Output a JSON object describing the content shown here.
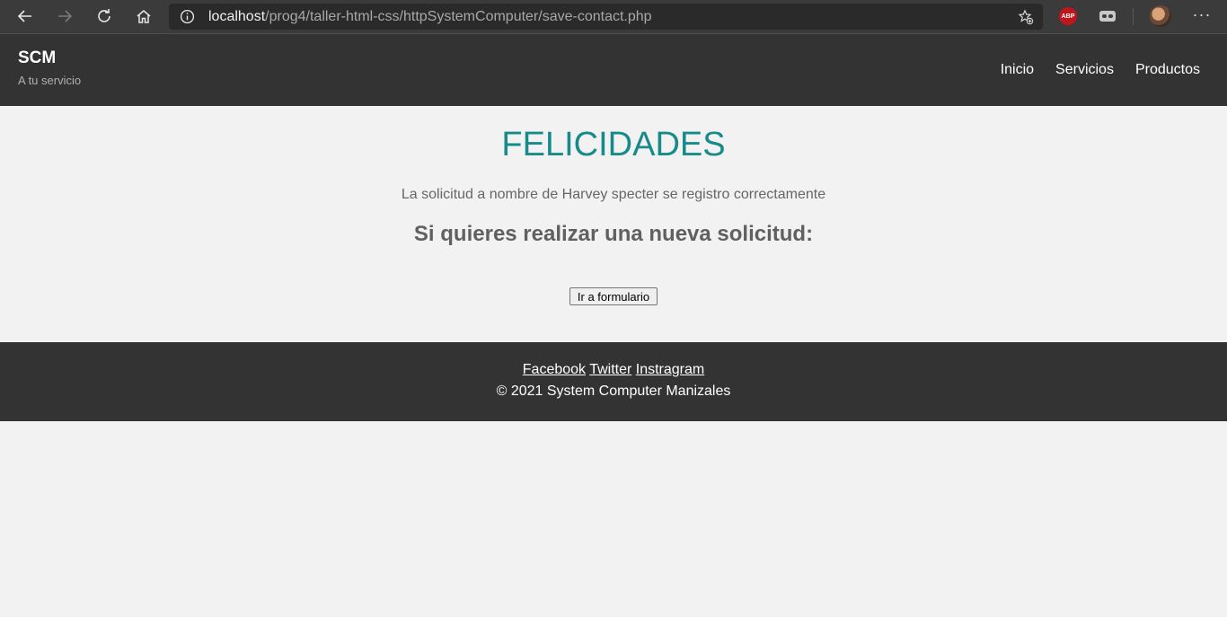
{
  "browser": {
    "url_host": "localhost",
    "url_path": "/prog4/taller-html-css/httpSystemComputer/save-contact.php",
    "abp_label": "ABP",
    "more_label": "···"
  },
  "header": {
    "brand": "SCM",
    "tagline": "A tu servicio",
    "nav": [
      "Inicio",
      "Servicios",
      "Productos"
    ]
  },
  "main": {
    "title": "FELICIDADES",
    "message": "La solicitud a nombre de Harvey specter se registro correctamente",
    "subheading": "Si quieres realizar una nueva solicitud:",
    "button_label": "Ir a formulario"
  },
  "footer": {
    "social": [
      "Facebook",
      "Twitter",
      "Instragram"
    ],
    "copyright": "© 2021 System Computer Manizales"
  },
  "colors": {
    "title": "#178a8a",
    "header_bg": "#333333",
    "page_bg": "#f2f2f2"
  }
}
